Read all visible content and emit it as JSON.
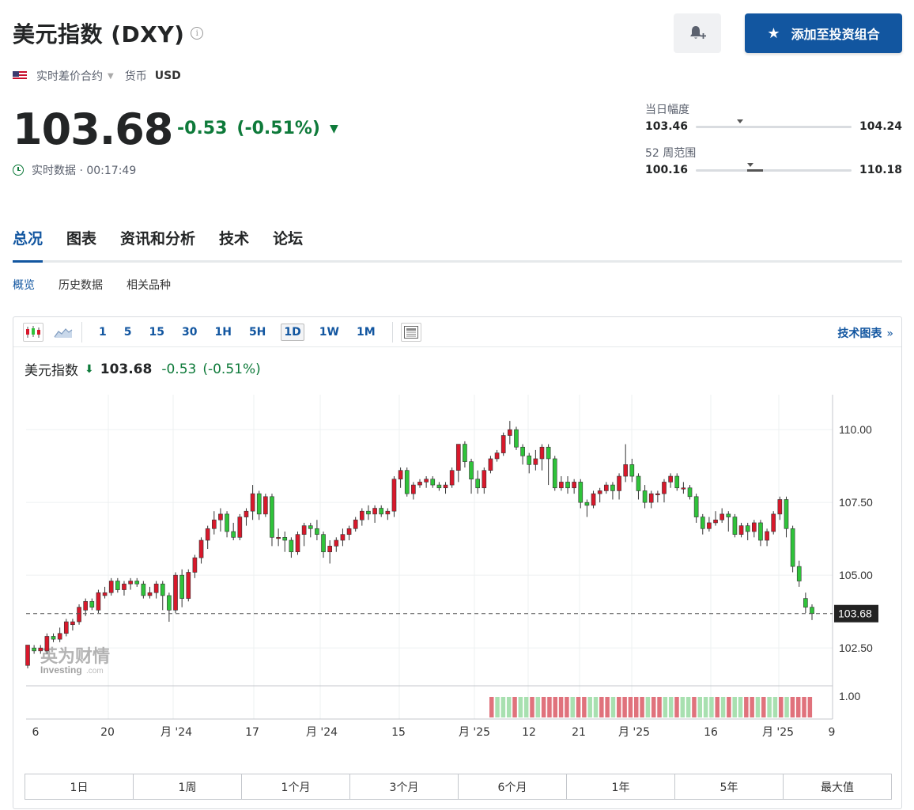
{
  "header": {
    "title": "美元指数 (DXY)",
    "info_icon": "info-icon",
    "alert_icon": "bell-plus-icon",
    "watchlist_label": "添加至投资组合",
    "watchlist_icon": "star-icon"
  },
  "meta": {
    "flag_icon": "us-flag-icon",
    "contract_type": "实时差价合约",
    "currency_label": "货币",
    "currency": "USD"
  },
  "quote": {
    "price": "103.68",
    "change": "-0.53",
    "change_pct": "(-0.51%)",
    "status": "实时数据 · 00:17:49",
    "colors": {
      "down": "#0e7a3a",
      "up": "#d8182b",
      "accent": "#1256a0"
    }
  },
  "day_range": {
    "label": "当日幅度",
    "low": "103.46",
    "high": "104.24",
    "current": 103.68
  },
  "week52_range": {
    "label": "52 周范围",
    "low": "100.16",
    "high": "110.18",
    "current": 103.68
  },
  "main_tabs": [
    {
      "label": "总况",
      "active": true
    },
    {
      "label": "图表",
      "active": false
    },
    {
      "label": "资讯和分析",
      "active": false
    },
    {
      "label": "技术",
      "active": false
    },
    {
      "label": "论坛",
      "active": false
    }
  ],
  "sub_tabs": [
    {
      "label": "概览",
      "active": true
    },
    {
      "label": "历史数据",
      "active": false
    },
    {
      "label": "相关品种",
      "active": false
    }
  ],
  "toolbar": {
    "intervals": [
      "1",
      "5",
      "15",
      "30",
      "1H",
      "5H",
      "1D",
      "1W",
      "1M"
    ],
    "active_interval": "1D",
    "tech_chart_link": "技术图表",
    "tech_chart_chevron": "»"
  },
  "legend": {
    "name": "美元指数",
    "price": "103.68",
    "change": "-0.53",
    "change_pct": "(-0.51%)"
  },
  "watermark": {
    "cn": "英为财情",
    "en": "Investing",
    "suffix": ".com"
  },
  "range_buttons": [
    "1日",
    "1周",
    "1个月",
    "3个月",
    "6个月",
    "1年",
    "5年",
    "最大值"
  ],
  "chart_data": {
    "type": "candlestick",
    "ylim": [
      101.2,
      111.2
    ],
    "y_ticks": [
      "110.00",
      "107.50",
      "105.00",
      "102.50"
    ],
    "last_price_label": "103.68",
    "last_price": 103.68,
    "volume_tick": "1.00",
    "x_tick_labels": [
      "6",
      "20",
      "月 '24",
      "17",
      "月 '24",
      "15",
      "月 '25",
      "12",
      "21",
      "月 '25",
      "16",
      "月 '25",
      "9"
    ],
    "candles": [
      [
        101.9,
        102.6,
        101.8,
        102.6
      ],
      [
        102.5,
        102.4,
        102.3,
        102.6
      ],
      [
        102.4,
        102.5,
        102.3,
        102.6
      ],
      [
        102.4,
        102.9,
        102.3,
        103.0
      ],
      [
        102.9,
        102.8,
        102.7,
        103.0
      ],
      [
        102.8,
        103.0,
        102.7,
        103.2
      ],
      [
        103.0,
        103.4,
        102.9,
        103.5
      ],
      [
        103.3,
        103.4,
        103.1,
        103.5
      ],
      [
        103.4,
        103.9,
        103.3,
        104.0
      ],
      [
        103.8,
        104.1,
        103.6,
        104.2
      ],
      [
        104.1,
        103.9,
        103.8,
        104.2
      ],
      [
        103.8,
        104.4,
        103.7,
        104.5
      ],
      [
        104.3,
        104.4,
        104.2,
        104.6
      ],
      [
        104.4,
        104.8,
        104.3,
        104.9
      ],
      [
        104.8,
        104.5,
        104.4,
        104.9
      ],
      [
        104.5,
        104.7,
        104.3,
        104.8
      ],
      [
        104.7,
        104.8,
        104.5,
        104.9
      ],
      [
        104.8,
        104.7,
        104.6,
        104.9
      ],
      [
        104.7,
        104.3,
        104.2,
        104.8
      ],
      [
        104.3,
        104.4,
        104.2,
        104.6
      ],
      [
        104.4,
        104.7,
        104.2,
        104.8
      ],
      [
        104.7,
        104.3,
        103.8,
        104.8
      ],
      [
        104.3,
        103.8,
        103.4,
        104.4
      ],
      [
        103.8,
        105.0,
        103.7,
        105.1
      ],
      [
        105.0,
        104.2,
        103.9,
        105.2
      ],
      [
        104.2,
        105.1,
        104.1,
        105.2
      ],
      [
        105.1,
        105.6,
        104.9,
        105.7
      ],
      [
        105.6,
        106.2,
        105.4,
        106.3
      ],
      [
        106.2,
        106.6,
        105.9,
        106.7
      ],
      [
        106.6,
        106.9,
        106.4,
        107.2
      ],
      [
        106.9,
        107.1,
        106.5,
        107.3
      ],
      [
        107.1,
        106.5,
        106.3,
        107.2
      ],
      [
        106.5,
        106.3,
        106.2,
        106.8
      ],
      [
        106.3,
        107.0,
        106.2,
        107.1
      ],
      [
        107.0,
        107.2,
        106.7,
        107.3
      ],
      [
        107.2,
        107.8,
        106.9,
        108.1
      ],
      [
        107.8,
        107.1,
        106.9,
        107.9
      ],
      [
        107.1,
        107.7,
        107.0,
        107.8
      ],
      [
        107.7,
        106.3,
        106.0,
        107.8
      ],
      [
        106.3,
        106.3,
        106.0,
        106.6
      ],
      [
        106.3,
        106.2,
        105.8,
        106.5
      ],
      [
        106.2,
        105.8,
        105.6,
        106.3
      ],
      [
        105.8,
        106.4,
        105.7,
        106.5
      ],
      [
        106.4,
        106.7,
        106.0,
        106.8
      ],
      [
        106.7,
        106.6,
        106.3,
        106.8
      ],
      [
        106.6,
        106.4,
        106.2,
        106.9
      ],
      [
        106.4,
        105.8,
        105.6,
        106.5
      ],
      [
        105.8,
        106.0,
        105.4,
        106.2
      ],
      [
        106.0,
        106.2,
        105.8,
        106.3
      ],
      [
        106.2,
        106.4,
        106.0,
        106.6
      ],
      [
        106.4,
        106.6,
        106.2,
        106.7
      ],
      [
        106.6,
        106.9,
        106.5,
        107.0
      ],
      [
        106.9,
        107.2,
        106.7,
        107.3
      ],
      [
        107.2,
        107.1,
        106.9,
        107.4
      ],
      [
        107.1,
        107.3,
        106.8,
        107.4
      ],
      [
        107.3,
        107.1,
        107.0,
        107.4
      ],
      [
        107.1,
        107.2,
        106.9,
        107.3
      ],
      [
        107.2,
        108.3,
        107.0,
        108.4
      ],
      [
        108.3,
        108.6,
        108.0,
        108.7
      ],
      [
        108.6,
        107.8,
        107.7,
        108.7
      ],
      [
        107.8,
        108.1,
        107.6,
        108.2
      ],
      [
        108.1,
        108.2,
        108.0,
        108.3
      ],
      [
        108.2,
        108.3,
        108.0,
        108.4
      ],
      [
        108.3,
        108.1,
        108.0,
        108.4
      ],
      [
        108.1,
        108.0,
        107.9,
        108.2
      ],
      [
        108.0,
        108.1,
        107.8,
        108.2
      ],
      [
        108.1,
        108.6,
        108.0,
        108.7
      ],
      [
        108.6,
        109.5,
        108.2,
        109.5
      ],
      [
        109.5,
        108.9,
        108.7,
        109.6
      ],
      [
        108.9,
        108.3,
        107.8,
        109.0
      ],
      [
        108.3,
        108.0,
        107.8,
        108.6
      ],
      [
        108.0,
        108.6,
        107.8,
        108.7
      ],
      [
        108.6,
        109.0,
        108.5,
        109.1
      ],
      [
        109.0,
        109.2,
        108.9,
        109.3
      ],
      [
        109.2,
        109.8,
        109.1,
        109.9
      ],
      [
        109.8,
        110.0,
        109.5,
        110.3
      ],
      [
        110.0,
        109.4,
        109.3,
        110.1
      ],
      [
        109.4,
        109.1,
        108.8,
        109.5
      ],
      [
        109.1,
        108.8,
        108.5,
        109.2
      ],
      [
        108.8,
        109.0,
        108.6,
        109.3
      ],
      [
        109.0,
        109.4,
        108.6,
        109.5
      ],
      [
        109.4,
        109.0,
        108.1,
        109.5
      ],
      [
        109.0,
        108.0,
        107.9,
        109.1
      ],
      [
        108.0,
        108.2,
        107.9,
        108.4
      ],
      [
        108.2,
        108.0,
        107.8,
        108.4
      ],
      [
        108.0,
        108.2,
        107.8,
        108.3
      ],
      [
        108.2,
        107.5,
        107.3,
        108.3
      ],
      [
        107.5,
        107.4,
        107.0,
        107.6
      ],
      [
        107.4,
        107.8,
        107.3,
        107.9
      ],
      [
        107.8,
        107.9,
        107.5,
        108.0
      ],
      [
        107.9,
        108.1,
        107.8,
        108.2
      ],
      [
        108.1,
        107.9,
        107.6,
        108.2
      ],
      [
        107.9,
        108.4,
        107.6,
        108.5
      ],
      [
        108.4,
        108.8,
        108.2,
        109.5
      ],
      [
        108.8,
        108.4,
        108.2,
        109.0
      ],
      [
        108.4,
        107.9,
        107.6,
        108.5
      ],
      [
        107.9,
        107.5,
        107.3,
        108.1
      ],
      [
        107.5,
        107.8,
        107.3,
        107.9
      ],
      [
        107.8,
        107.8,
        107.5,
        107.9
      ],
      [
        107.8,
        108.2,
        107.5,
        108.3
      ],
      [
        108.2,
        108.4,
        108.0,
        108.5
      ],
      [
        108.4,
        108.0,
        107.9,
        108.5
      ],
      [
        108.0,
        108.0,
        107.8,
        108.2
      ],
      [
        108.0,
        107.7,
        107.6,
        108.1
      ],
      [
        107.7,
        107.0,
        106.8,
        107.8
      ],
      [
        107.0,
        106.6,
        106.4,
        107.1
      ],
      [
        106.6,
        106.8,
        106.5,
        107.0
      ],
      [
        106.8,
        106.9,
        106.7,
        107.2
      ],
      [
        106.9,
        107.1,
        106.8,
        107.3
      ],
      [
        107.1,
        107.0,
        106.5,
        107.2
      ],
      [
        107.0,
        106.4,
        106.3,
        107.1
      ],
      [
        106.4,
        106.7,
        106.3,
        106.8
      ],
      [
        106.7,
        106.5,
        106.2,
        106.8
      ],
      [
        106.5,
        106.8,
        106.3,
        106.9
      ],
      [
        106.8,
        106.2,
        106.0,
        106.9
      ],
      [
        106.2,
        106.5,
        106.0,
        106.6
      ],
      [
        106.5,
        107.1,
        106.4,
        107.2
      ],
      [
        107.1,
        107.6,
        106.9,
        107.7
      ],
      [
        107.6,
        106.6,
        106.3,
        107.7
      ],
      [
        106.6,
        105.3,
        105.1,
        106.7
      ],
      [
        105.3,
        104.8,
        104.6,
        105.5
      ],
      [
        104.2,
        103.9,
        103.7,
        104.4
      ],
      [
        103.9,
        103.68,
        103.46,
        104.0
      ]
    ],
    "volume_colors": [
      "r",
      "g",
      "g",
      "g",
      "r",
      "g",
      "g",
      "r",
      "g",
      "r",
      "r",
      "r",
      "r",
      "r",
      "g",
      "r",
      "r",
      "g",
      "g",
      "r",
      "r",
      "g",
      "r",
      "r",
      "r",
      "r",
      "r",
      "g",
      "r",
      "r",
      "g",
      "g",
      "r",
      "g",
      "g",
      "r",
      "g",
      "g",
      "g",
      "r",
      "g",
      "r",
      "g",
      "g",
      "r",
      "r",
      "g",
      "r",
      "g",
      "g",
      "r",
      "g",
      "r",
      "r",
      "r",
      "r"
    ]
  }
}
